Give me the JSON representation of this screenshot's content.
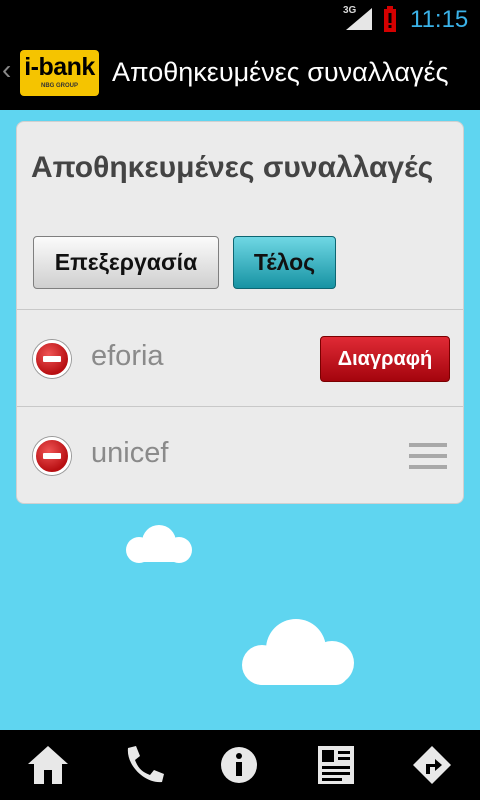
{
  "status_bar": {
    "network": "3G",
    "time": "11:15",
    "signal_icon": "signal-icon",
    "battery_icon": "battery-alert-icon",
    "battery_color": "#d40000",
    "time_color": "#3ab2e8"
  },
  "action_bar": {
    "logo_brand": "i-bank",
    "logo_sub": "NBG GROUP",
    "title": "Αποθηκευμένες συναλλαγές",
    "logo_color": "#f5c400"
  },
  "card": {
    "title": "Αποθηκευμένες συναλλαγές",
    "edit_label": "Επεξεργασία",
    "done_label": "Τέλος",
    "items": [
      {
        "name": "eforia",
        "delete_label": "Διαγραφή"
      },
      {
        "name": "unicef"
      }
    ]
  },
  "bottom_nav": {
    "items": [
      "home-icon",
      "phone-icon",
      "info-icon",
      "contacts-icon",
      "directions-icon"
    ]
  },
  "colors": {
    "background": "#5fd5f0",
    "done_button": "#1793a3",
    "delete_button": "#c8101a"
  }
}
